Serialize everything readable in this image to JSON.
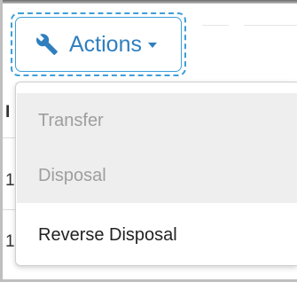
{
  "actions_button": {
    "label": "Actions",
    "icon": "wrench-icon",
    "caret_icon": "caret-down-icon",
    "accent_color": "#2f7fbf"
  },
  "background_table": {
    "header_fragment": "I",
    "row_fragments": [
      "1",
      "1"
    ]
  },
  "dropdown": {
    "items": [
      {
        "label": "Transfer",
        "disabled": true
      },
      {
        "label": "Disposal",
        "disabled": true
      },
      {
        "label": "Reverse Disposal",
        "disabled": false
      }
    ]
  }
}
